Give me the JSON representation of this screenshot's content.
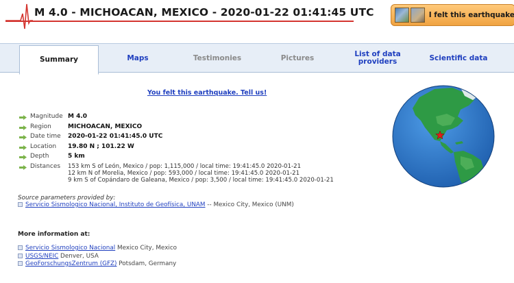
{
  "header": {
    "title": "M 4.0 - MICHOACAN, MEXICO - 2020-01-22 01:41:45 UTC",
    "felt_button": "I felt this earthquake"
  },
  "tabs": [
    {
      "label": "Summary",
      "state": "active"
    },
    {
      "label": "Maps",
      "state": "link"
    },
    {
      "label": "Testimonies",
      "state": "disabled"
    },
    {
      "label": "Pictures",
      "state": "disabled"
    },
    {
      "label": "List of data providers",
      "state": "link"
    },
    {
      "label": "Scientific data",
      "state": "link"
    }
  ],
  "felt_link": "You felt this earthquake. Tell us!",
  "params": {
    "magnitude": {
      "label": "Magnitude",
      "value": "M 4.0"
    },
    "region": {
      "label": "Region",
      "value": "MICHOACAN, MEXICO"
    },
    "datetime": {
      "label": "Date time",
      "value": "2020-01-22 01:41:45.0 UTC"
    },
    "location": {
      "label": "Location",
      "value": "19.80 N ; 101.22 W"
    },
    "depth": {
      "label": "Depth",
      "value": "5 km"
    },
    "distances": {
      "label": "Distances",
      "lines": [
        "153 km S of León, Mexico / pop: 1,115,000 / local time: 19:41:45.0 2020-01-21",
        "12 km N of Morelia, Mexico / pop: 593,000 / local time: 19:41:45.0 2020-01-21",
        "9 km S of Copándaro de Galeana, Mexico / pop: 3,500 / local time: 19:41:45.0 2020-01-21"
      ]
    }
  },
  "source": {
    "heading": "Source parameters provided by:",
    "link": "Servicio Sismologico Nacional, Instituto de Geofísica, UNAM",
    "rest": " -- Mexico City, Mexico (UNM)"
  },
  "more": {
    "heading": "More information at:",
    "items": [
      {
        "link": "Servicio Sismologico Nacional",
        "rest": " Mexico City, Mexico"
      },
      {
        "link": "USGS/NEIC",
        "rest": " Denver, USA"
      },
      {
        "link": "GeoForschungsZentrum (GFZ)",
        "rest": " Potsdam, Germany"
      }
    ]
  },
  "colors": {
    "accent_red": "#d4342f",
    "link_blue": "#1f3fbf",
    "tab_bar": "#e7eef7",
    "felt_button": "#f0a341",
    "arrow_green": "#7bb34a"
  },
  "icons": {
    "seismogram": "seismogram-icon",
    "param_arrow": "green-arrow-icon",
    "link_bullet": "link-bullet-icon",
    "epicenter": "red-star-icon"
  }
}
